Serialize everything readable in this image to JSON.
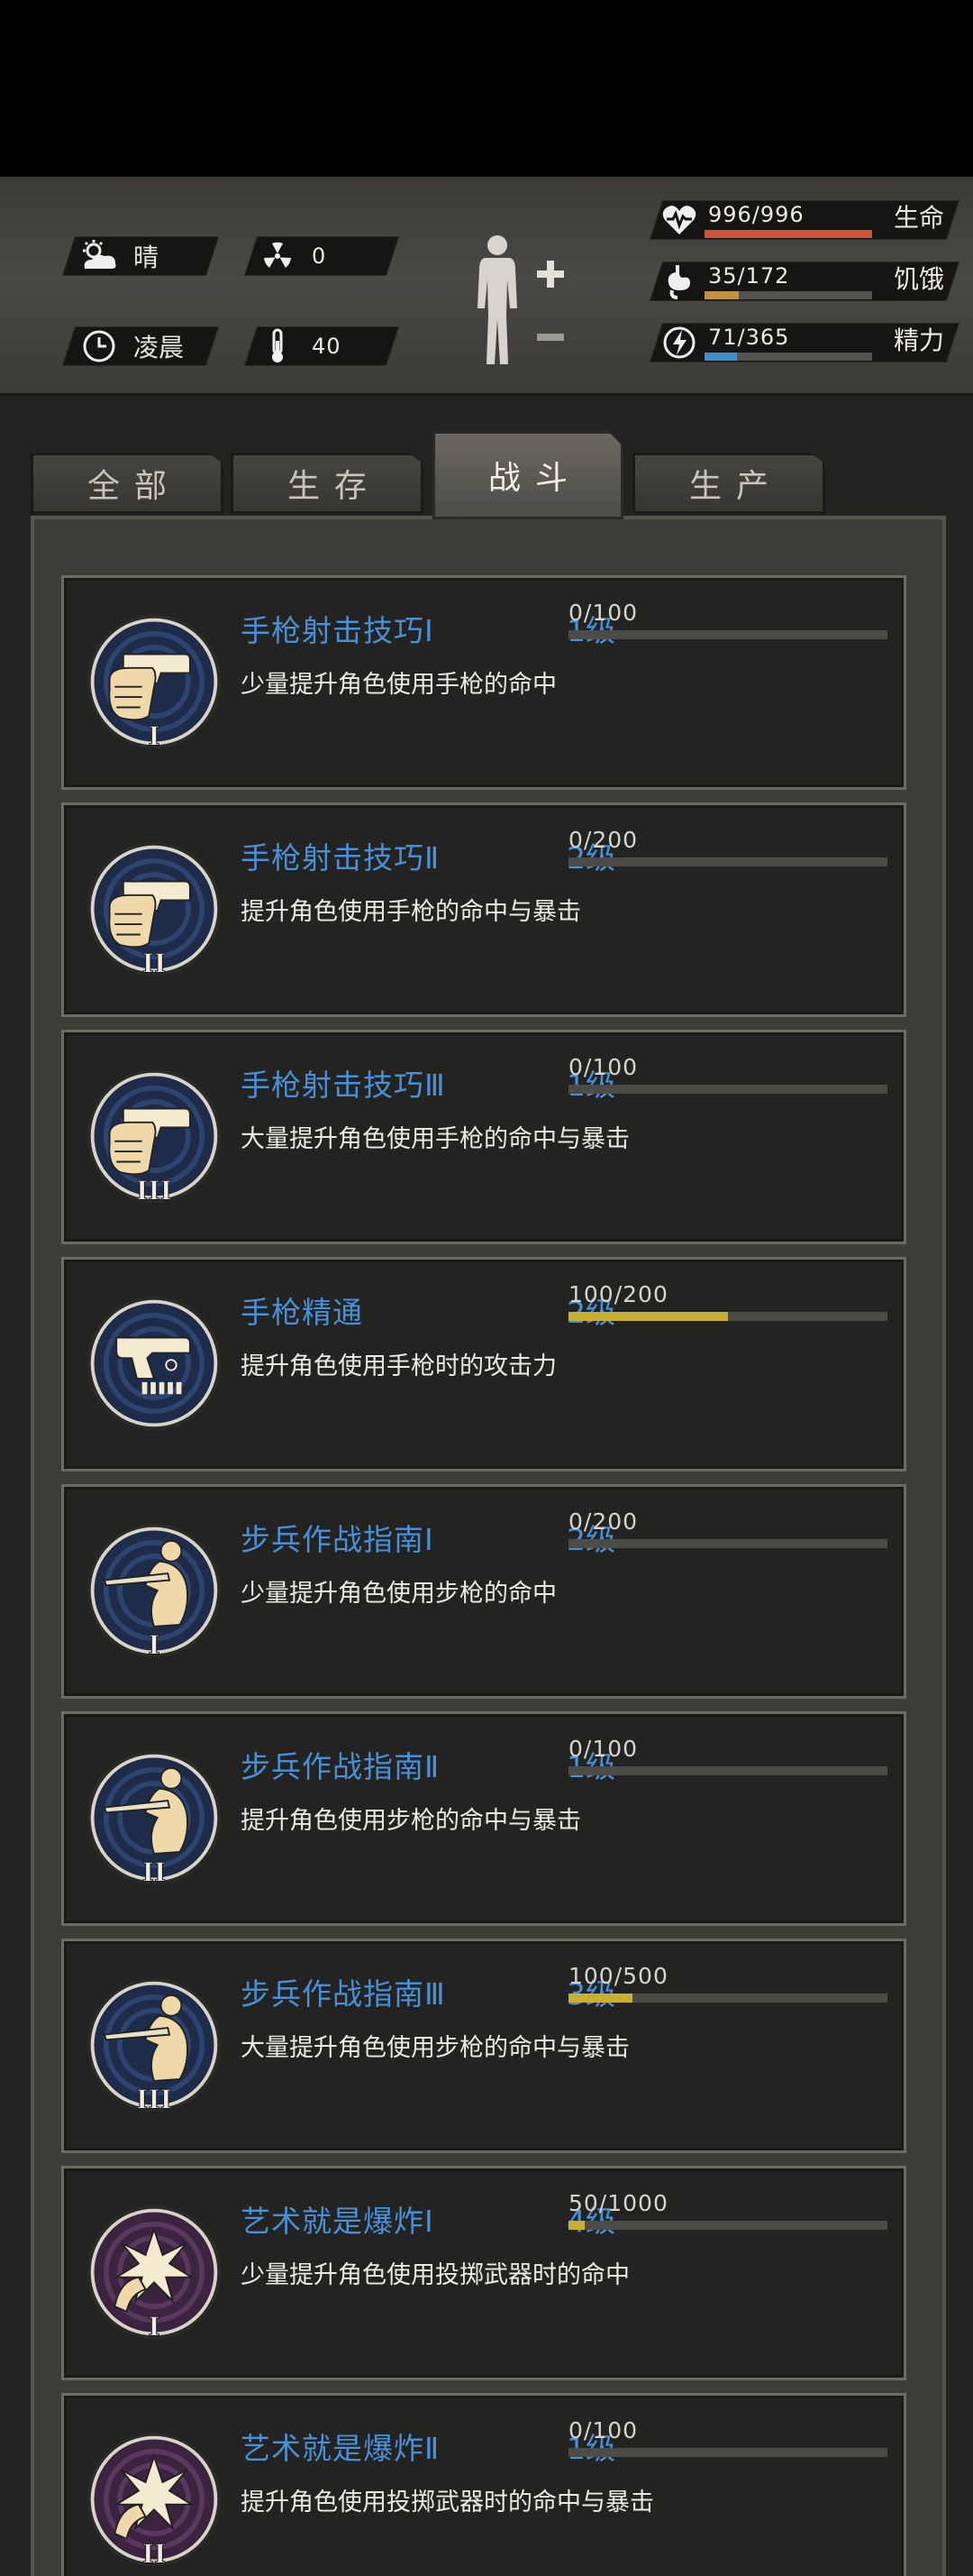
{
  "hud": {
    "weather": "晴",
    "radiation": "0",
    "time_of_day": "凌晨",
    "temperature": "40",
    "stats": [
      {
        "label": "生命",
        "value": "996/996",
        "current": 996,
        "max": 996,
        "color": "#d0543a",
        "icon": "heartbeat-icon"
      },
      {
        "label": "饥饿",
        "value": "35/172",
        "current": 35,
        "max": 172,
        "color": "#c78f3b",
        "icon": "stomach-icon"
      },
      {
        "label": "精力",
        "value": "71/365",
        "current": 71,
        "max": 365,
        "color": "#3f8fd0",
        "icon": "energy-icon"
      }
    ]
  },
  "tabs": [
    {
      "label": "全部",
      "active": false
    },
    {
      "label": "生存",
      "active": false
    },
    {
      "label": "战斗",
      "active": true
    },
    {
      "label": "生产",
      "active": false
    }
  ],
  "skills": [
    {
      "name": "手枪射击技巧Ⅰ",
      "level": "1级",
      "xp": "0/100",
      "current": 0,
      "max": 100,
      "desc": "少量提升角色使用手枪的命中",
      "icon": "pistol-hand-icon",
      "numeral": "I",
      "theme": "blue"
    },
    {
      "name": "手枪射击技巧Ⅱ",
      "level": "2级",
      "xp": "0/200",
      "current": 0,
      "max": 200,
      "desc": "提升角色使用手枪的命中与暴击",
      "icon": "pistol-hand-icon",
      "numeral": "II",
      "theme": "blue"
    },
    {
      "name": "手枪射击技巧Ⅲ",
      "level": "1级",
      "xp": "0/100",
      "current": 0,
      "max": 100,
      "desc": "大量提升角色使用手枪的命中与暴击",
      "icon": "pistol-hand-icon",
      "numeral": "III",
      "theme": "blue"
    },
    {
      "name": "手枪精通",
      "level": "2级",
      "xp": "100/200",
      "current": 100,
      "max": 200,
      "desc": "提升角色使用手枪时的攻击力",
      "icon": "pistol-ammo-icon",
      "numeral": "",
      "theme": "blue"
    },
    {
      "name": "步兵作战指南Ⅰ",
      "level": "2级",
      "xp": "0/200",
      "current": 0,
      "max": 200,
      "desc": "少量提升角色使用步枪的命中",
      "icon": "rifleman-icon",
      "numeral": "I",
      "theme": "blue"
    },
    {
      "name": "步兵作战指南Ⅱ",
      "level": "1级",
      "xp": "0/100",
      "current": 0,
      "max": 100,
      "desc": "提升角色使用步枪的命中与暴击",
      "icon": "rifleman-icon",
      "numeral": "II",
      "theme": "blue"
    },
    {
      "name": "步兵作战指南Ⅲ",
      "level": "3级",
      "xp": "100/500",
      "current": 100,
      "max": 500,
      "desc": "大量提升角色使用步枪的命中与暴击",
      "icon": "rifleman-icon",
      "numeral": "III",
      "theme": "blue"
    },
    {
      "name": "艺术就是爆炸Ⅰ",
      "level": "4级",
      "xp": "50/1000",
      "current": 50,
      "max": 1000,
      "desc": "少量提升角色使用投掷武器时的命中",
      "icon": "explosion-icon",
      "numeral": "I",
      "theme": "purple"
    },
    {
      "name": "艺术就是爆炸Ⅱ",
      "level": "1级",
      "xp": "0/100",
      "current": 0,
      "max": 100,
      "desc": "提升角色使用投掷武器时的命中与暴击",
      "icon": "explosion-icon",
      "numeral": "II",
      "theme": "purple"
    }
  ]
}
